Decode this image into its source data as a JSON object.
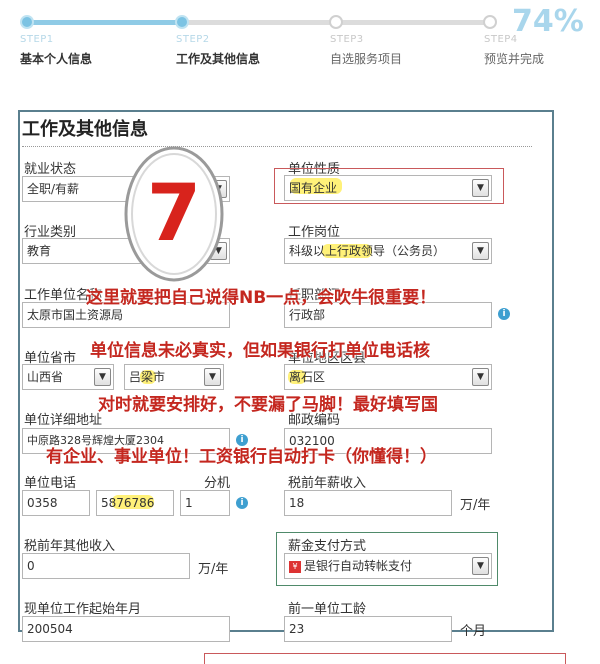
{
  "progress": {
    "percent": "74%",
    "steps": [
      {
        "no": "STEP1",
        "name": "基本个人信息"
      },
      {
        "no": "STEP2",
        "name": "工作及其他信息"
      },
      {
        "no": "STEP3",
        "name": "自选服务项目"
      },
      {
        "no": "STEP4",
        "name": "预览并完成"
      }
    ]
  },
  "section_title": "工作及其他信息",
  "badge_number": "7",
  "fields": {
    "employment_status": {
      "label": "就业状态",
      "value": "全职/有薪"
    },
    "unit_nature": {
      "label": "单位性质",
      "value": "国有企业"
    },
    "industry": {
      "label": "行业类别",
      "value": "教育"
    },
    "job_position": {
      "label": "工作岗位",
      "value": "科级以上行政领导（公务员）"
    },
    "unit_name": {
      "label": "工作单位名称",
      "value": "太原市国土资源局"
    },
    "department": {
      "label": "任职部门",
      "value": "行政部"
    },
    "unit_province": {
      "label": "单位省市",
      "value": "山西省"
    },
    "unit_city": {
      "value": "吕梁市"
    },
    "unit_district": {
      "label": "单位地区区县",
      "value": "离石区"
    },
    "unit_address": {
      "label": "单位详细地址",
      "value": "中原路328号辉煌大厦2304"
    },
    "postal_code": {
      "label": "邮政编码",
      "value": "032100"
    },
    "unit_phone": {
      "label": "单位电话",
      "area": "0358",
      "number": "5876786",
      "ext_label": "分机",
      "ext": "1"
    },
    "annual_salary": {
      "label": "税前年薪收入",
      "value": "18",
      "unit": "万/年"
    },
    "other_income": {
      "label": "税前年其他收入",
      "value": "0",
      "unit": "万/年"
    },
    "salary_payment": {
      "label": "薪金支付方式",
      "value": "是银行自动转帐支付"
    },
    "start_month": {
      "label": "现单位工作起始年月",
      "value": "200504"
    },
    "prev_seniority": {
      "label": "前一单位工龄",
      "value": "23",
      "unit": "个月"
    }
  },
  "annotations": [
    "这里就要把自己说得NB一点，会吹牛很重要！",
    "单位信息未必真实，但如果银行打单位电话核",
    "对时就要安排好，不要漏了马脚！最好填写国",
    "有企业、事业单位！工资银行自动打卡（你懂得！）"
  ]
}
